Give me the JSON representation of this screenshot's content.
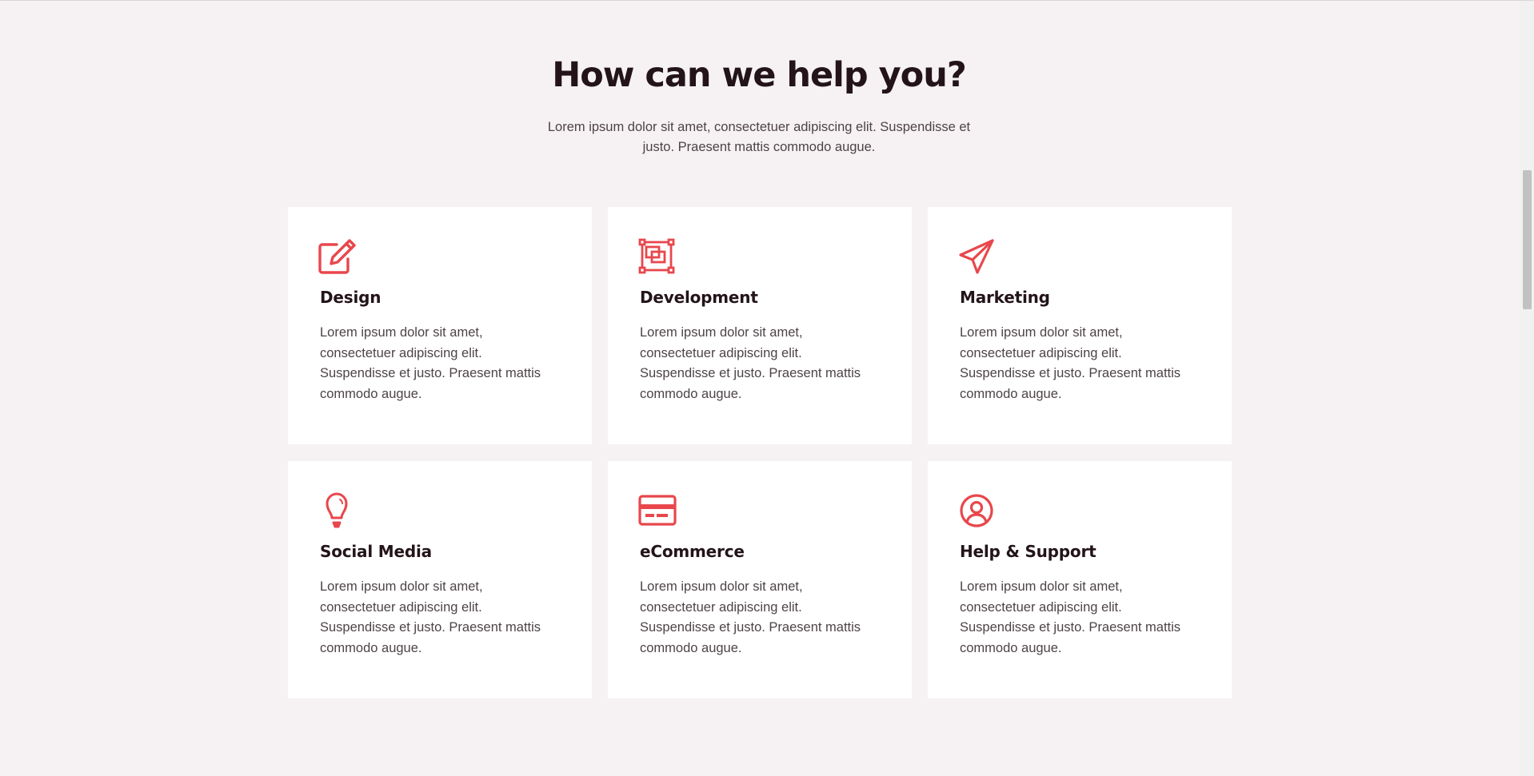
{
  "section": {
    "title": "How can we help you?",
    "subtitle": "Lorem ipsum dolor sit amet, consectetuer adipiscing elit. Suspendisse et justo. Praesent mattis commodo augue."
  },
  "accent_color": "#e8474c",
  "services": [
    {
      "icon": "pencil-square-icon",
      "title": "Design",
      "text": "Lorem ipsum dolor sit amet, consectetuer adipiscing elit. Suspendisse et justo. Praesent mattis commodo augue."
    },
    {
      "icon": "layers-icon",
      "title": "Development",
      "text": "Lorem ipsum dolor sit amet, consectetuer adipiscing elit. Suspendisse et justo. Praesent mattis commodo augue."
    },
    {
      "icon": "paper-plane-icon",
      "title": "Marketing",
      "text": "Lorem ipsum dolor sit amet, consectetuer adipiscing elit. Suspendisse et justo. Praesent mattis commodo augue."
    },
    {
      "icon": "lightbulb-icon",
      "title": "Social Media",
      "text": "Lorem ipsum dolor sit amet, consectetuer adipiscing elit. Suspendisse et justo. Praesent mattis commodo augue."
    },
    {
      "icon": "credit-card-icon",
      "title": "eCommerce",
      "text": "Lorem ipsum dolor sit amet, consectetuer adipiscing elit. Suspendisse et justo. Praesent mattis commodo augue."
    },
    {
      "icon": "user-circle-icon",
      "title": "Help & Support",
      "text": "Lorem ipsum dolor sit amet, consectetuer adipiscing elit. Suspendisse et justo. Praesent mattis commodo augue."
    }
  ]
}
